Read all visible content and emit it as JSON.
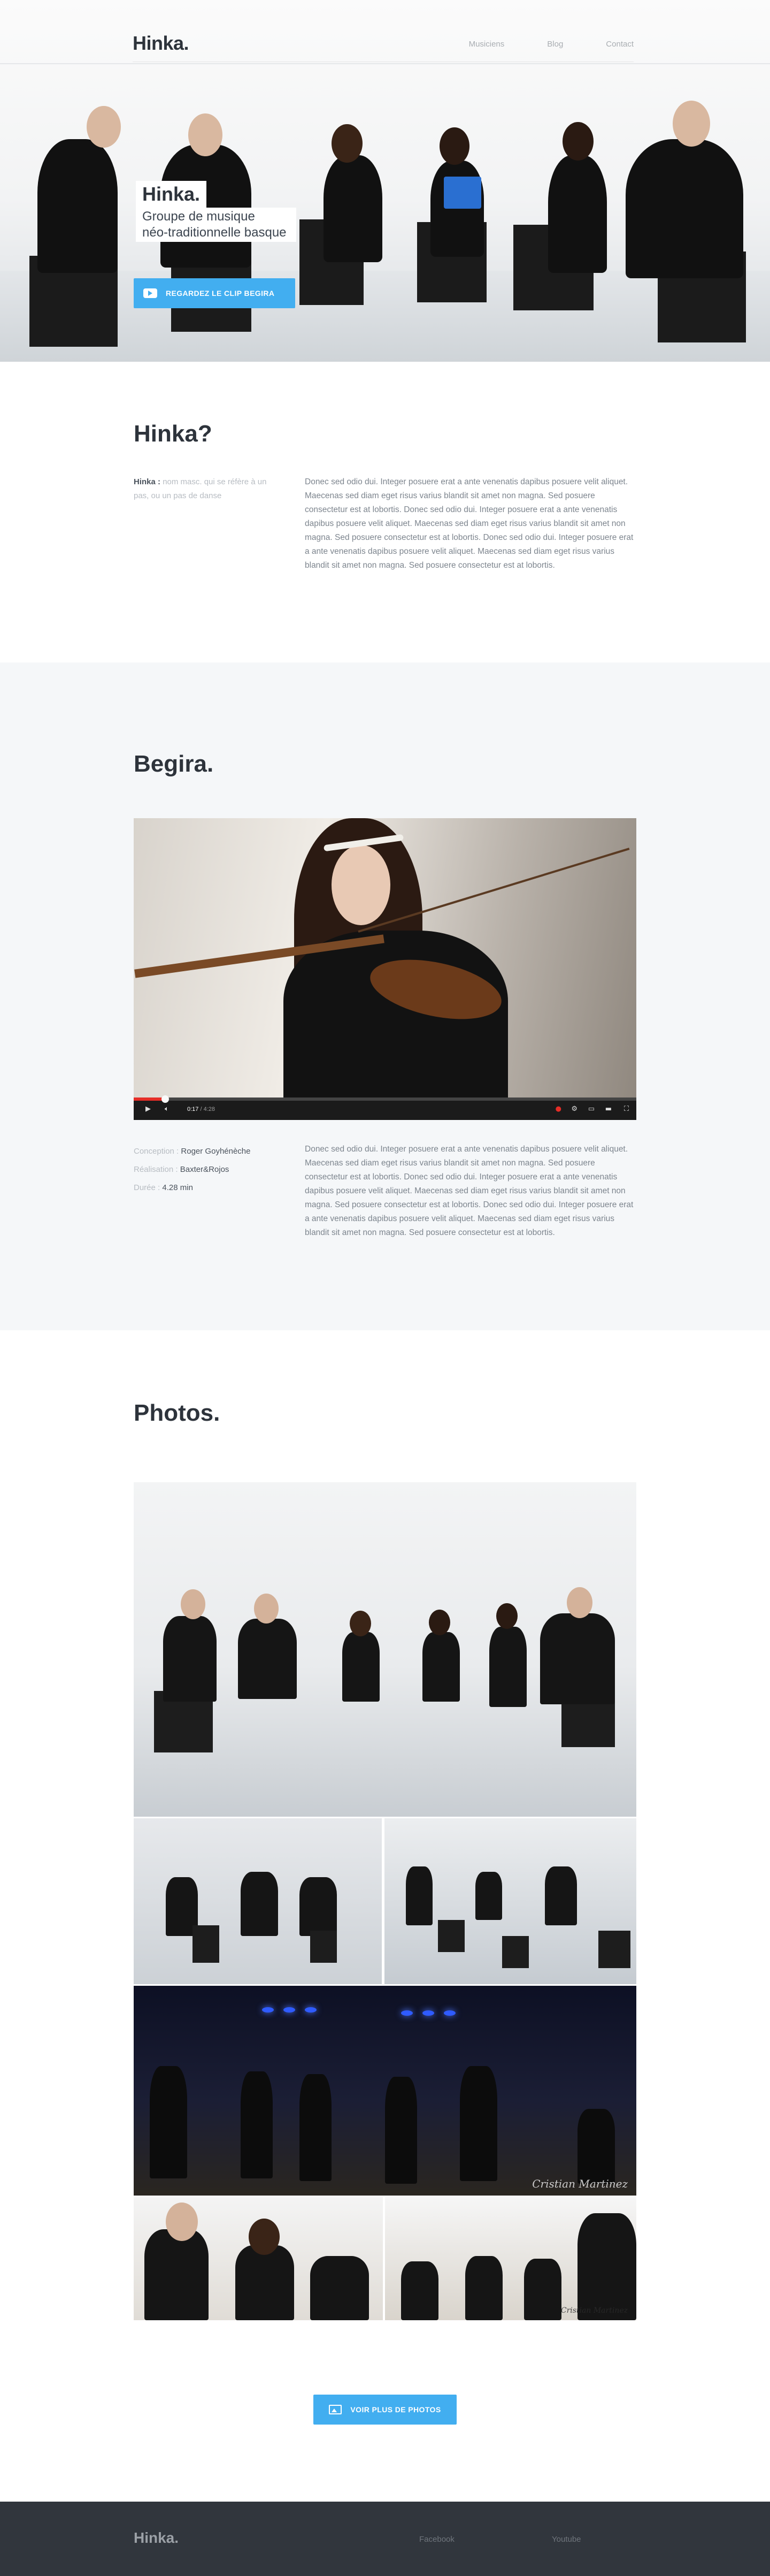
{
  "header": {
    "logo": "Hinka.",
    "nav": [
      "Musiciens",
      "Blog",
      "Contact"
    ]
  },
  "hero": {
    "title": "Hinka.",
    "subtitle_line1": "Groupe de musique",
    "subtitle_line2": "néo-traditionnelle basque",
    "cta_label": "REGARDEZ LE CLIP BEGIRA"
  },
  "about": {
    "title": "Hinka?",
    "definition_term": "Hinka :",
    "definition_text": "nom masc. qui se réfère à un pas, ou un pas de danse",
    "paragraph": "Donec sed odio dui. Integer posuere erat a ante venenatis dapibus posuere velit aliquet. Maecenas sed diam eget risus varius blandit sit amet non magna. Sed posuere consectetur est at lobortis. Donec sed odio dui. Integer posuere erat a ante venenatis dapibus posuere velit aliquet. Maecenas sed diam eget risus varius blandit sit amet non magna. Sed posuere consectetur est at lobortis. Donec sed odio dui. Integer posuere erat a ante venenatis dapibus posuere velit aliquet. Maecenas sed diam eget risus varius blandit sit amet non magna. Sed posuere consectetur est at lobortis."
  },
  "video_section": {
    "title": "Begira.",
    "player": {
      "current_time": "0:17",
      "duration": "4:28",
      "progress_fraction": 0.063
    },
    "credits": [
      {
        "label": "Conception :",
        "value": "Roger Goyhénèche"
      },
      {
        "label": "Réalisation :",
        "value": "Baxter&Rojos"
      },
      {
        "label": "Durée :",
        "value": "4.28 min"
      }
    ],
    "paragraph": "Donec sed odio dui. Integer posuere erat a ante venenatis dapibus posuere velit aliquet. Maecenas sed diam eget risus varius blandit sit amet non magna. Sed posuere consectetur est at lobortis. Donec sed odio dui. Integer posuere erat a ante venenatis dapibus posuere velit aliquet. Maecenas sed diam eget risus varius blandit sit amet non magna. Sed posuere consectetur est at lobortis. Donec sed odio dui. Integer posuere erat a ante venenatis dapibus posuere velit aliquet. Maecenas sed diam eget risus varius blandit sit amet non magna. Sed posuere consectetur est at lobortis."
  },
  "photos_section": {
    "title": "Photos.",
    "watermark": "Cristian Martinez",
    "more_label": "VOIR PLUS DE PHOTOS"
  },
  "footer": {
    "logo": "Hinka.",
    "links": [
      "Facebook",
      "Youtube"
    ]
  },
  "colors": {
    "accent": "#42aef0",
    "heading": "#2d333b",
    "footer_bg": "#31363d",
    "video_progress": "#e52d27"
  }
}
